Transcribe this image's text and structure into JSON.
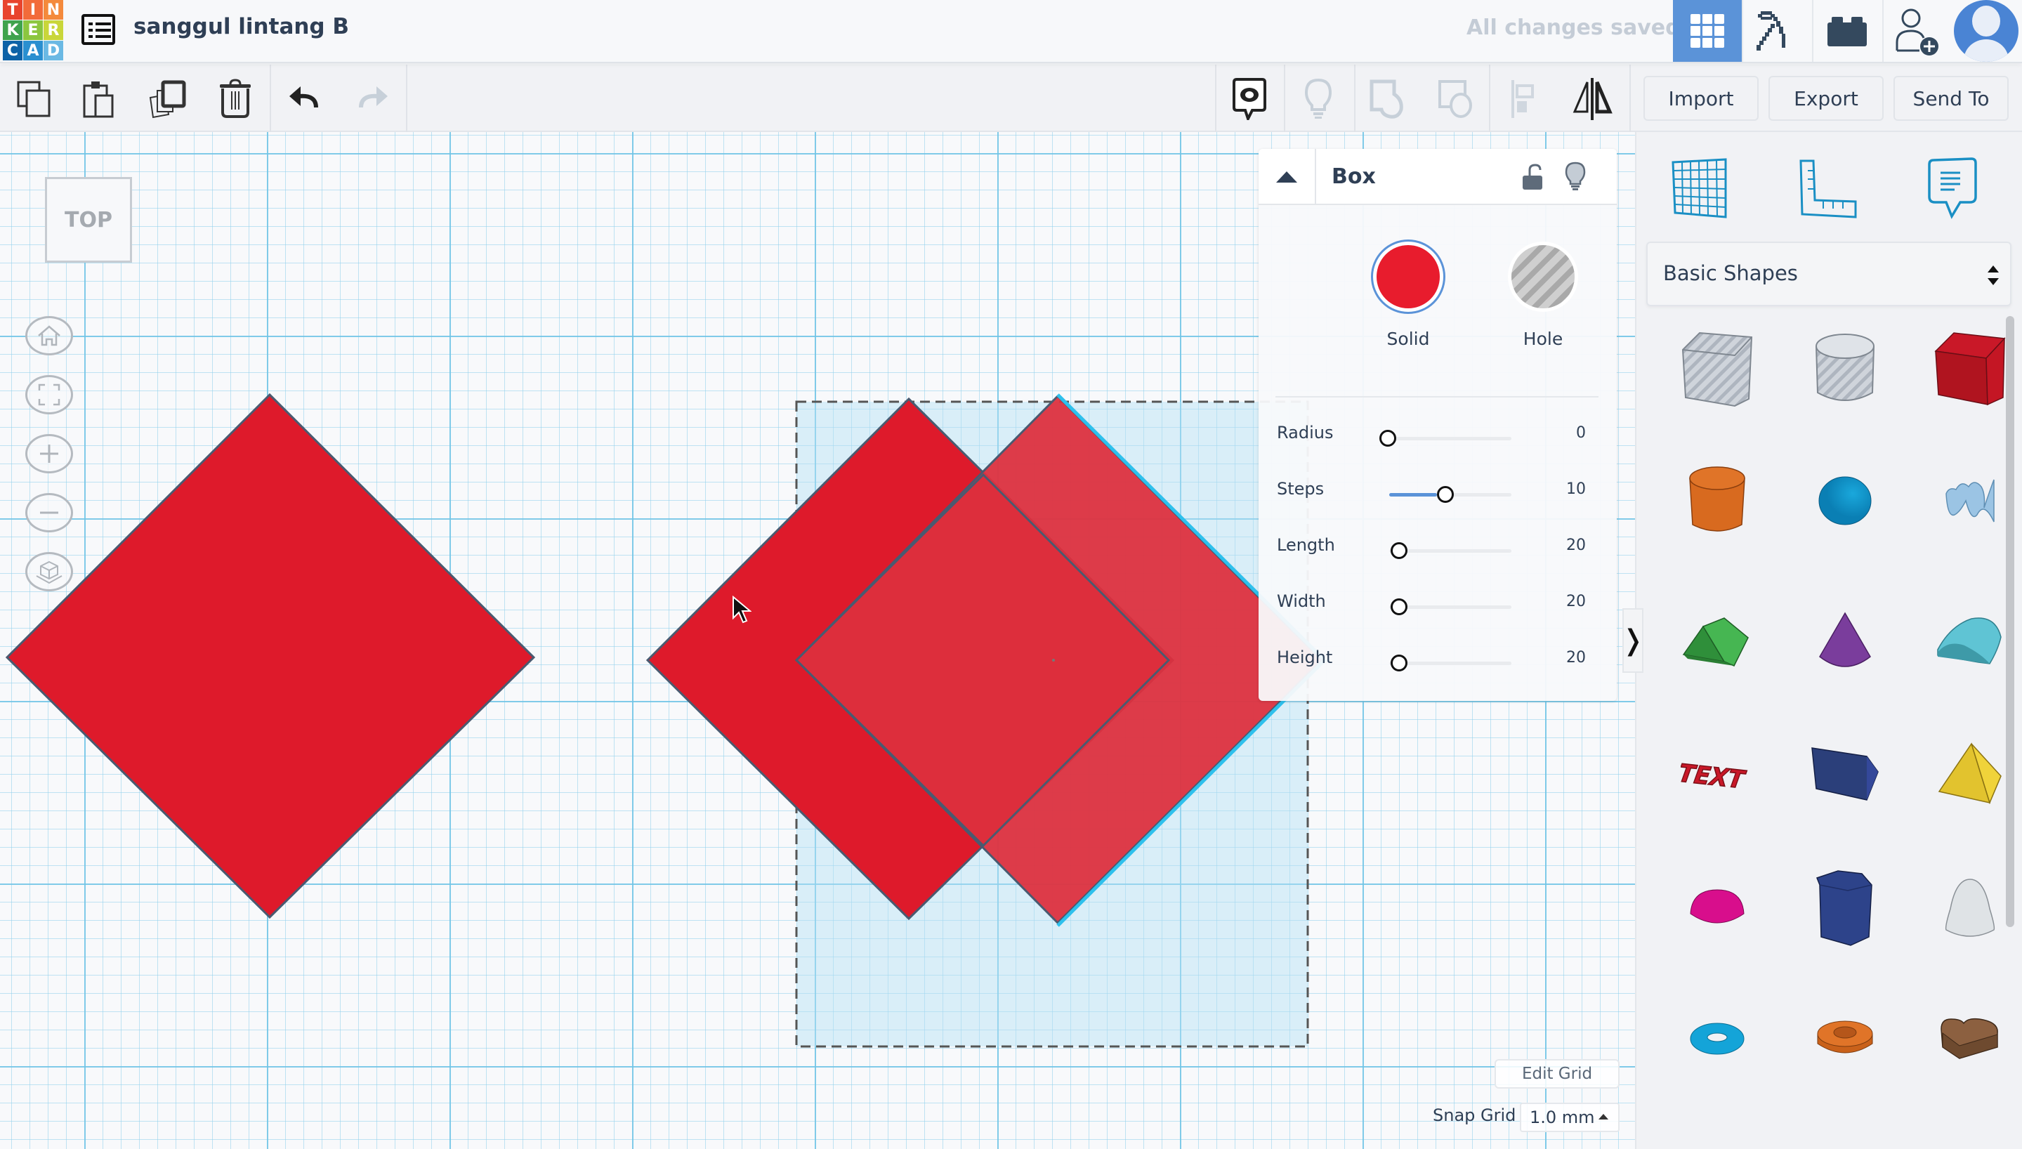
{
  "app": {
    "logo_letters": [
      "T",
      "I",
      "N",
      "K",
      "E",
      "R",
      "C",
      "A",
      "D"
    ],
    "logo_colors": [
      "#e8442e",
      "#f26b3a",
      "#f48a3c",
      "#3fa34d",
      "#8cc63f",
      "#c9d63a",
      "#0e62a7",
      "#2a8fd0",
      "#6bb9e4"
    ],
    "project_title": "sanggul lintang B",
    "save_status": "All changes saved",
    "accent_color": "#5b93d8"
  },
  "topbar": {
    "buttons": [
      {
        "name": "3d-design-view",
        "icon": "grid-icon",
        "active": true
      },
      {
        "name": "codeblocks-view",
        "icon": "pickaxe-icon",
        "active": false
      },
      {
        "name": "bricks-view",
        "icon": "brick-icon",
        "active": false
      },
      {
        "name": "invite-user",
        "icon": "user-add-icon",
        "active": false
      }
    ]
  },
  "toolbar": {
    "left_tools": [
      {
        "name": "copy",
        "icon": "copy-icon",
        "enabled": true
      },
      {
        "name": "paste",
        "icon": "paste-icon",
        "enabled": true
      },
      {
        "name": "duplicate",
        "icon": "duplicate-icon",
        "enabled": true
      },
      {
        "name": "delete",
        "icon": "trash-icon",
        "enabled": true
      },
      {
        "name": "undo",
        "icon": "undo-icon",
        "enabled": true
      },
      {
        "name": "redo",
        "icon": "redo-icon",
        "enabled": false
      }
    ],
    "right_tools": [
      {
        "name": "notes",
        "icon": "notes-eye-icon",
        "enabled": true
      },
      {
        "name": "show-all",
        "icon": "lightbulb-icon",
        "enabled": false
      },
      {
        "name": "group",
        "icon": "group-icon",
        "enabled": false
      },
      {
        "name": "ungroup",
        "icon": "ungroup-icon",
        "enabled": false
      },
      {
        "name": "align",
        "icon": "align-icon",
        "enabled": false
      },
      {
        "name": "mirror",
        "icon": "mirror-icon",
        "enabled": true
      }
    ],
    "import_label": "Import",
    "export_label": "Export",
    "send_to_label": "Send To"
  },
  "canvas": {
    "view_cube_label": "TOP",
    "nav_buttons": [
      {
        "name": "home-view",
        "icon": "home-icon"
      },
      {
        "name": "fit-view",
        "icon": "fit-icon"
      },
      {
        "name": "zoom-in",
        "icon": "plus-icon"
      },
      {
        "name": "zoom-out",
        "icon": "minus-icon"
      },
      {
        "name": "perspective-toggle",
        "icon": "cube-icon"
      }
    ],
    "shape_color": "#de1a2b",
    "shape_color_selected": "#dd3a47",
    "edit_grid_label": "Edit Grid",
    "snap_grid_label": "Snap Grid",
    "snap_grid_value": "1.0 mm"
  },
  "inspector": {
    "title": "Box",
    "solid_label": "Solid",
    "hole_label": "Hole",
    "solid_color": "#e81c2d",
    "selected_material": "Solid",
    "properties": [
      {
        "label": "Radius",
        "value": "0",
        "fraction": 0.0
      },
      {
        "label": "Steps",
        "value": "10",
        "fraction": 0.5
      },
      {
        "label": "Length",
        "value": "20",
        "fraction": 0.1
      },
      {
        "label": "Width",
        "value": "20",
        "fraction": 0.1
      },
      {
        "label": "Height",
        "value": "20",
        "fraction": 0.1
      }
    ]
  },
  "sidebar": {
    "tools": [
      {
        "name": "workplane",
        "icon": "workplane-grid-icon"
      },
      {
        "name": "ruler",
        "icon": "ruler-icon"
      },
      {
        "name": "notes",
        "icon": "note-bubble-icon"
      }
    ],
    "category": "Basic Shapes",
    "shapes": [
      {
        "name": "box-hole",
        "icon": "box-hole-icon"
      },
      {
        "name": "cylinder-hole",
        "icon": "cylinder-hole-icon"
      },
      {
        "name": "box",
        "icon": "box-icon"
      },
      {
        "name": "cylinder",
        "icon": "cylinder-icon"
      },
      {
        "name": "sphere",
        "icon": "sphere-icon"
      },
      {
        "name": "scribble",
        "icon": "scribble-icon"
      },
      {
        "name": "roof",
        "icon": "roof-icon"
      },
      {
        "name": "cone",
        "icon": "cone-icon"
      },
      {
        "name": "round-roof",
        "icon": "round-roof-icon"
      },
      {
        "name": "text",
        "icon": "text-icon"
      },
      {
        "name": "polygon",
        "icon": "polygon-icon"
      },
      {
        "name": "pyramid",
        "icon": "pyramid-icon"
      },
      {
        "name": "half-sphere",
        "icon": "half-sphere-icon"
      },
      {
        "name": "hexagonal-prism",
        "icon": "hexagonal-prism-icon"
      },
      {
        "name": "paraboloid",
        "icon": "paraboloid-icon"
      },
      {
        "name": "torus",
        "icon": "torus-icon"
      },
      {
        "name": "tube",
        "icon": "tube-icon"
      },
      {
        "name": "heart",
        "icon": "heart-icon"
      }
    ]
  }
}
